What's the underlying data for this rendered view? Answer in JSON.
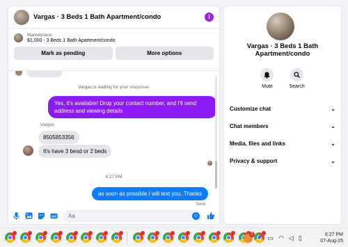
{
  "chat": {
    "title": "Vargas · 3 Beds 1 Bath Apartment/condo",
    "info_icon": "info-icon",
    "listing": {
      "label": "Marketplace",
      "title": "$1,000 - 3 Beds 1 Bath Apartment/condo"
    },
    "actions": {
      "mark_pending": "Mark as pending",
      "more_options": "More options"
    },
    "system_note": "Vargas is waiting for your response.",
    "messages": [
      {
        "from": "me",
        "text": "Yes, it's available! Drop your contact number, and I'll send address and viewing details"
      },
      {
        "from": "them",
        "sender": "Vargas",
        "text": "8505853356"
      },
      {
        "from": "them",
        "text": "It's have 3 besd or 2 beds"
      },
      {
        "from": "me",
        "text": "as soon as possible I will text you..Thanks"
      }
    ],
    "timestamp": "6:27 PM",
    "sent_label": "Sent",
    "composer": {
      "placeholder": "Aa",
      "icons": [
        "mic-icon",
        "image-icon",
        "sticker-icon",
        "gif-icon",
        "emoji-icon",
        "like-icon"
      ]
    }
  },
  "profile": {
    "title": "Vargas · 3 Beds 1 Bath Apartment/condo",
    "mute_label": "Mute",
    "search_label": "Search",
    "menu": [
      {
        "label": "Customize chat"
      },
      {
        "label": "Chat members"
      },
      {
        "label": "Media, files and links"
      },
      {
        "label": "Privacy & support"
      }
    ]
  },
  "taskbar": {
    "pinned_app_count": 17,
    "tray_notification_count": "2",
    "time": "6:27 PM",
    "date": "07-Aug-25",
    "colors": {
      "messenger_purple": "#8a1bf2",
      "blue": "#0a7cff"
    }
  }
}
